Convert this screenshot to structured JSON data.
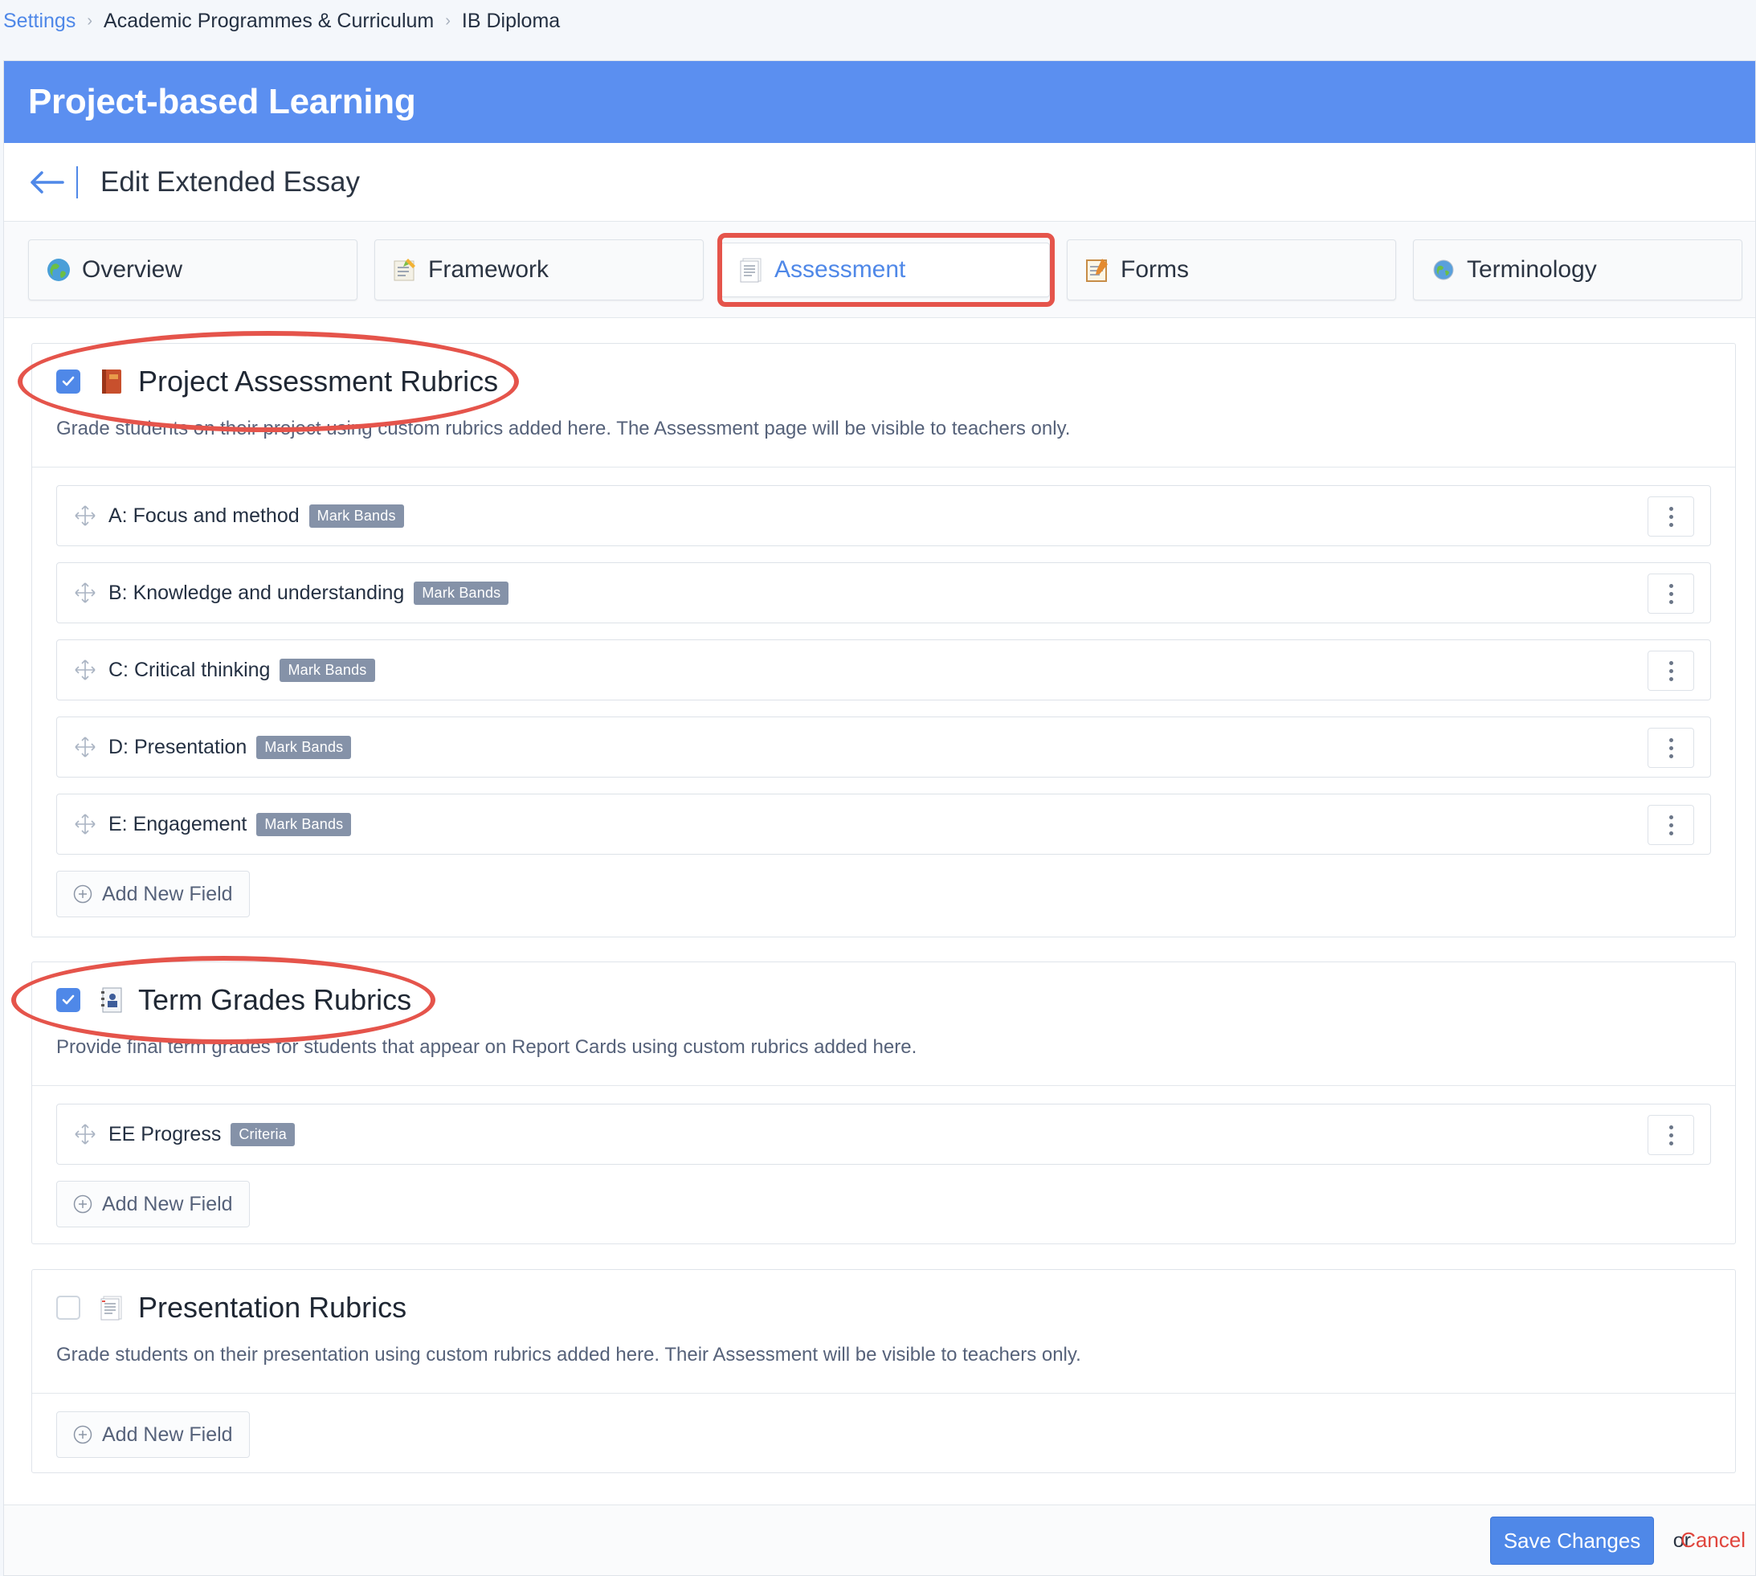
{
  "breadcrumb": {
    "root": "Settings",
    "level1": "Academic Programmes & Curriculum",
    "level2": "IB Diploma",
    "separator": "›"
  },
  "banner": {
    "title": "Project-based Learning"
  },
  "edit_header": {
    "title": "Edit Extended Essay"
  },
  "tabs": [
    {
      "label": "Overview",
      "icon": "globe-icon"
    },
    {
      "label": "Framework",
      "icon": "memo-icon"
    },
    {
      "label": "Assessment",
      "icon": "document-icon",
      "active": true
    },
    {
      "label": "Forms",
      "icon": "notepad-icon"
    },
    {
      "label": "Terminology",
      "icon": "globe-small-icon"
    }
  ],
  "sections": [
    {
      "title": "Project Assessment Rubrics",
      "checked": true,
      "icon": "book-icon",
      "description": "Grade students on their project using custom rubrics added here. The Assessment page will be visible to teachers only.",
      "fields": [
        {
          "label": "A: Focus and method",
          "badge": "Mark Bands"
        },
        {
          "label": "B: Knowledge and understanding",
          "badge": "Mark Bands"
        },
        {
          "label": "C: Critical thinking",
          "badge": "Mark Bands"
        },
        {
          "label": "D: Presentation",
          "badge": "Mark Bands"
        },
        {
          "label": "E: Engagement",
          "badge": "Mark Bands"
        }
      ],
      "add_label": "Add New Field"
    },
    {
      "title": "Term Grades Rubrics",
      "checked": true,
      "icon": "report-card-icon",
      "description": "Provide final term grades for students that appear on Report Cards using custom rubrics added here.",
      "fields": [
        {
          "label": "EE Progress",
          "badge": "Criteria"
        }
      ],
      "add_label": "Add New Field"
    },
    {
      "title": "Presentation Rubrics",
      "checked": false,
      "icon": "document-icon",
      "description": "Grade students on their presentation using custom rubrics added here. Their Assessment will be visible to teachers only.",
      "fields": [],
      "add_label": "Add New Field"
    }
  ],
  "footer": {
    "save_label": "Save Changes",
    "or_text": "or",
    "cancel_label": "Cancel"
  },
  "colors": {
    "accent": "#4f88e8",
    "banner": "#5b8ff0",
    "badge": "#8592a8",
    "annotation": "#e5544b",
    "cancel": "#e0453d"
  }
}
